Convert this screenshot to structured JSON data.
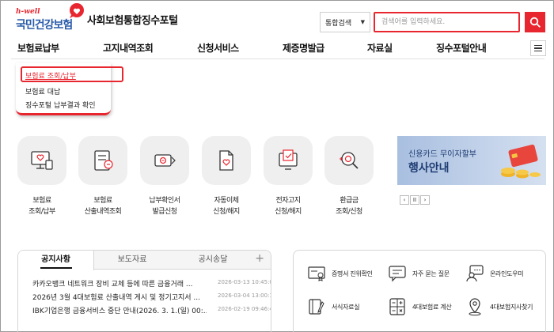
{
  "header": {
    "logo_tagline": "h-well",
    "logo_org": "국민건강보험",
    "portal_title": "사회보험통합징수포털",
    "search_scope": "통합검색",
    "search_placeholder": "검색어를 입력하세요."
  },
  "gnb": {
    "items": [
      {
        "label": "보험료납부"
      },
      {
        "label": "고지내역조회"
      },
      {
        "label": "신청서비스"
      },
      {
        "label": "제증명발급"
      },
      {
        "label": "자료실"
      },
      {
        "label": "징수포털안내"
      }
    ]
  },
  "dropdown": {
    "items": [
      {
        "label": "보험료 조회/납부",
        "active": true
      },
      {
        "label": "보험료 대납"
      },
      {
        "label": "징수포털 납부결과 확인"
      }
    ]
  },
  "quick_services": [
    {
      "line1": "보험료",
      "line2": "조회/납부",
      "icon": "monitor-heart-icon"
    },
    {
      "line1": "보험료",
      "line2": "산출내역조회",
      "icon": "calculator-document-icon"
    },
    {
      "line1": "납부확인서",
      "line2": "발급신청",
      "icon": "certificate-print-icon"
    },
    {
      "line1": "자동이체",
      "line2": "신청/해지",
      "icon": "document-heart-icon"
    },
    {
      "line1": "전자고지",
      "line2": "신청/해지",
      "icon": "electronic-notice-icon"
    },
    {
      "line1": "환급금",
      "line2": "조회/신청",
      "icon": "refund-search-icon"
    }
  ],
  "banner": {
    "subtitle": "신용카드 무이자할부",
    "title": "행사안내",
    "controls": [
      "‹",
      "II",
      "›"
    ]
  },
  "board": {
    "tabs": [
      {
        "label": "공지사항",
        "active": true
      },
      {
        "label": "보도자료"
      },
      {
        "label": "공시송달"
      }
    ],
    "more": "+",
    "notices": [
      {
        "title": "카카오뱅크 네트워크 장비 교체 등에 따른 금융거래 ...",
        "date": "2026-03-13 10:45:05.0"
      },
      {
        "title": "2026년 3월 4대보험료 산출내역 게시 및 정기고지서 ...",
        "date": "2026-03-04 13:00:19.0"
      },
      {
        "title": "IBK기업은행 금융서비스 중단 안내(2026. 3. 1.(일) 00:...",
        "date": "2026-02-19 09:46:40.0"
      }
    ]
  },
  "menu_box": [
    {
      "label": "증명서 진위확인",
      "icon": "certificate-verify-icon"
    },
    {
      "label": "자주 묻는 질문",
      "icon": "faq-chat-icon"
    },
    {
      "label": "온라인도우미",
      "icon": "online-helper-icon"
    },
    {
      "label": "서식자료실",
      "icon": "form-library-icon"
    },
    {
      "label": "4대보험료 계산",
      "icon": "insurance-calculator-icon"
    },
    {
      "label": "4대보험지사찾기",
      "icon": "branch-locator-icon"
    }
  ],
  "colors": {
    "accent": "#e8262f",
    "brand_blue": "#2a5caa",
    "banner_text": "#1f3d73",
    "tile_bg": "#efefef"
  }
}
